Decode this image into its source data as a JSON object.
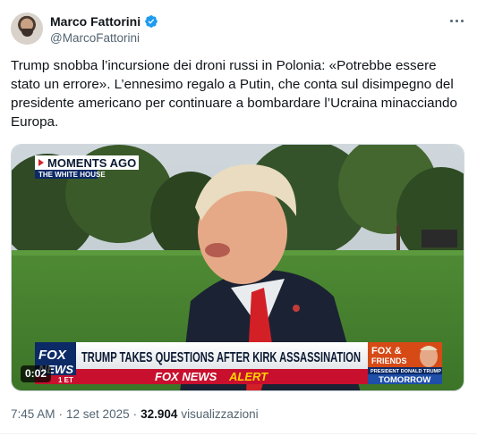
{
  "author": {
    "display_name": "Marco Fattorini",
    "handle": "@MarcoFattorini",
    "verified": true,
    "verified_color": "#1d9bf0"
  },
  "tweet": {
    "text": "Trump snobba l’incursione dei droni russi in Polonia: «Potrebbe essere stato un errore». L’ennesimo regalo a Putin, che conta sul disimpegno del presidente americano per continuare a bombardare l’Ucraina minacciando Europa."
  },
  "media": {
    "type": "video",
    "duration": "0:02",
    "overlay": {
      "moments_ago": "MOMENTS AGO",
      "location": "THE WHITE HOUSE",
      "headline": "TRUMP TAKES QUESTIONS AFTER KIRK ASSASSINATION",
      "network_logo_top": "FOX",
      "network_logo_bottom": "NEWS",
      "clock": "1 ET",
      "alert_brand": "FOX NEWS",
      "alert_word": "ALERT",
      "promo_show_top": "FOX &",
      "promo_show_bottom": "FRIENDS",
      "promo_guest": "PRESIDENT DONALD TRUMP",
      "promo_when": "TOMORROW"
    }
  },
  "meta": {
    "time": "7:45 AM",
    "date": "12 set 2025",
    "views_count": "32.904",
    "views_label": "visualizzazioni"
  },
  "icons": {
    "more": "more-dots-icon",
    "verified": "verified-badge-icon"
  }
}
